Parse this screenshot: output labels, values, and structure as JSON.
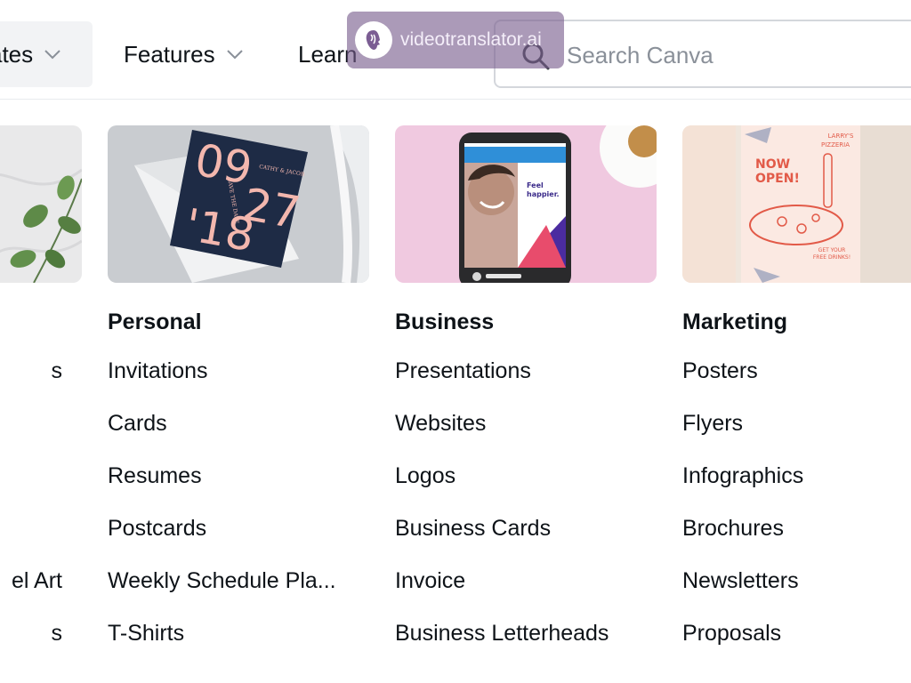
{
  "nav": {
    "templates_label": "ates",
    "features_label": "Features",
    "learn_label": "Learn"
  },
  "search": {
    "placeholder": "Search Canva"
  },
  "watermark": {
    "text": "videotranslator.ai"
  },
  "thumbnails": {
    "personal": {
      "card_lines": [
        "09",
        "27",
        "'18"
      ],
      "small_text": [
        "CATHY & JACOB",
        "SAVE THE DATE"
      ]
    },
    "business": {
      "phone_text": [
        "Feel",
        "happier."
      ]
    },
    "marketing": {
      "poster_lines": [
        "LARRY'S",
        "PIZZERIA",
        "NOW",
        "OPEN!",
        "GET YOUR",
        "FREE DRINKS!"
      ]
    }
  },
  "columns": [
    {
      "heading": "",
      "items": [
        "s",
        "",
        "",
        "",
        "el Art",
        "s"
      ]
    },
    {
      "heading": "Personal",
      "items": [
        "Invitations",
        "Cards",
        "Resumes",
        "Postcards",
        "Weekly Schedule Pla...",
        "T-Shirts"
      ]
    },
    {
      "heading": "Business",
      "items": [
        "Presentations",
        "Websites",
        "Logos",
        "Business Cards",
        "Invoice",
        "Business Letterheads"
      ],
      "active_item": "Logos"
    },
    {
      "heading": "Marketing",
      "items": [
        "Posters",
        "Flyers",
        "Infographics",
        "Brochures",
        "Newsletters",
        "Proposals"
      ]
    }
  ],
  "colors": {
    "text": "#0e1318",
    "hover_bg": "#f2f3f5",
    "border": "#d4d7dc",
    "placeholder": "#8a9099",
    "watermark_bg": "#785c8c"
  },
  "icons": [
    "chevron-down-icon",
    "search-icon",
    "watermark-logo-icon"
  ]
}
